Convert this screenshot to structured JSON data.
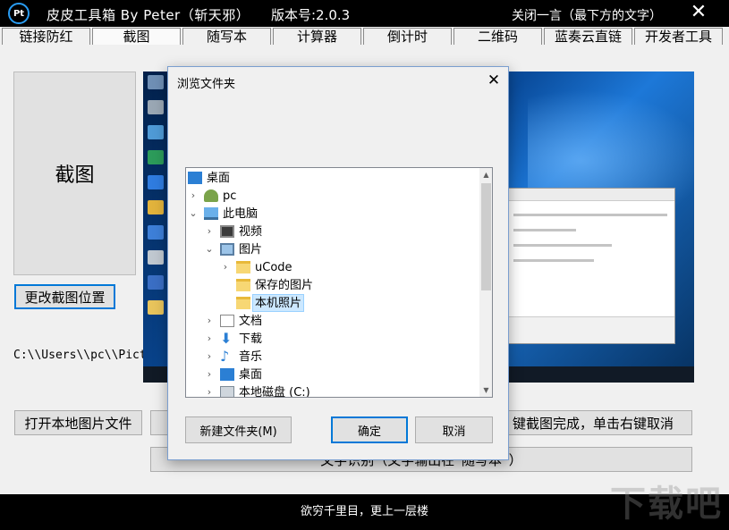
{
  "window": {
    "logo": "Pt",
    "title": "皮皮工具箱 By Peter（斩天邪）",
    "version": "版本号:2.0.3",
    "close_quote": "关闭一言（最下方的文字）",
    "close_symbol": "✕"
  },
  "tabs": [
    {
      "label": "链接防红"
    },
    {
      "label": "截图"
    },
    {
      "label": "随写本"
    },
    {
      "label": "计算器"
    },
    {
      "label": "倒计时"
    },
    {
      "label": "二维码"
    },
    {
      "label": "蓝奏云直链"
    },
    {
      "label": "开发者工具"
    }
  ],
  "active_tab": "截图",
  "main": {
    "screenshot_button": "截图",
    "change_location_button": "更改截图位置",
    "path": "C:\\\\Users\\\\pc\\\\Pictures",
    "open_local_button": "打开本地图片文件",
    "hint_button": "键截图完成，单击右键取消",
    "ocr_button": "文字识别（文字输出在“随写本”）"
  },
  "status_text": "欲穷千里目，更上一层楼",
  "watermark": "下载吧",
  "dialog": {
    "title": "浏览文件夹",
    "close_symbol": "✕",
    "tree": [
      {
        "label": "桌面",
        "expander": "",
        "icon": "desktop-icon"
      },
      {
        "label": "pc",
        "expander": "›",
        "icon": "user-icon"
      },
      {
        "label": "此电脑",
        "expander": "⌄",
        "icon": "computer-icon"
      },
      {
        "label": "视频",
        "expander": "›",
        "icon": "video-icon"
      },
      {
        "label": "图片",
        "expander": "⌄",
        "icon": "pictures-icon"
      },
      {
        "label": "uCode",
        "expander": "›",
        "icon": "folder-icon"
      },
      {
        "label": "保存的图片",
        "expander": "",
        "icon": "folder-icon"
      },
      {
        "label": "本机照片",
        "expander": "",
        "icon": "folder-icon",
        "selected": true
      },
      {
        "label": "文档",
        "expander": "›",
        "icon": "documents-icon"
      },
      {
        "label": "下载",
        "expander": "›",
        "icon": "download-icon"
      },
      {
        "label": "音乐",
        "expander": "›",
        "icon": "music-icon"
      },
      {
        "label": "桌面",
        "expander": "›",
        "icon": "desktop-icon"
      },
      {
        "label": "本地磁盘 (C:)",
        "expander": "›",
        "icon": "disk-icon"
      }
    ],
    "new_folder_button": "新建文件夹(M)",
    "ok_button": "确定",
    "cancel_button": "取消"
  },
  "colors": {
    "title_bar": "#000000",
    "accent": "#0078d7",
    "selection": "#cce8ff",
    "desktop_blue": "#0a4c9c"
  }
}
